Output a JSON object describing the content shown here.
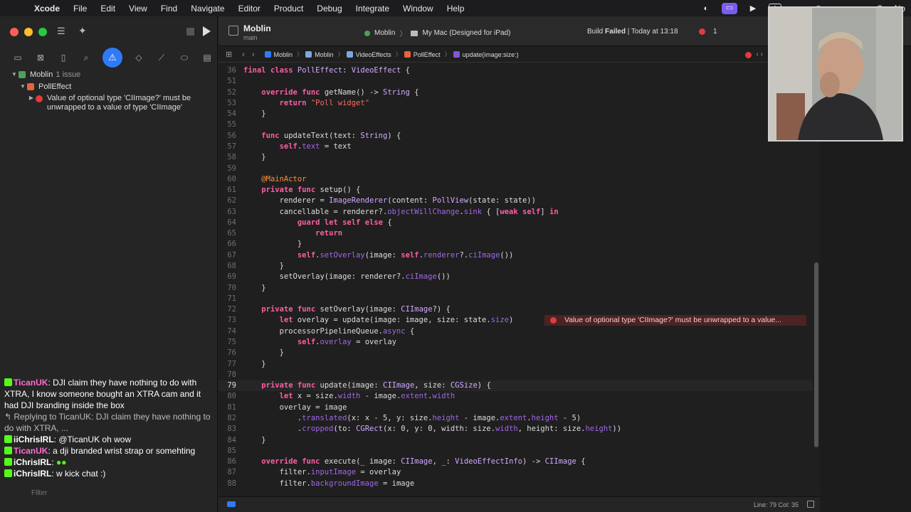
{
  "menubar": {
    "app_name": "Xcode",
    "items": [
      "File",
      "Edit",
      "View",
      "Find",
      "Navigate",
      "Editor",
      "Product",
      "Debug",
      "Integrate",
      "Window",
      "Help"
    ],
    "clock": "Sun No"
  },
  "toolbar": {
    "project_name": "Moblin",
    "branch": "main",
    "scheme": "Moblin",
    "destination": "My Mac (Designed for iPad)",
    "status_prefix": "Build",
    "status_bold": "Failed",
    "status_suffix": "| Today at 13:18",
    "error_count": "1"
  },
  "jumpbar": {
    "crumbs": [
      "Moblin",
      "Moblin",
      "VideoEffects",
      "PollEffect",
      "update(image:size:)"
    ]
  },
  "navigator": {
    "project": "Moblin",
    "issue_count": "1 issue",
    "file": "PollEffect",
    "error_message": "Value of optional type 'CIImage?' must be unwrapped to a value of type 'CIImage'"
  },
  "chat": {
    "msg1_user": "TicanUK",
    "msg1_text": ": DJI claim they have nothing to do with XTRA, I know someone bought an XTRA cam and it had DJI branding inside the box",
    "reply": "Replying to TicanUK: DJI claim they have nothing to do with XTRA, ...",
    "msg2_user": "iiChrisIRL",
    "msg2_text": ": @TicanUK oh wow",
    "msg3_user": "TicanUK",
    "msg3_text": ": a dji branded wrist strap or somehting",
    "msg4_user": "iChrisIRL",
    "msg4_text": ":",
    "msg5_user": "iChrisIRL",
    "msg5_text": ": w kick chat :)",
    "filter_placeholder": "Filter"
  },
  "editor": {
    "inline_error": "Value of optional type 'CIImage?' must be unwrapped to a value...",
    "lines": [
      {
        "n": "36",
        "code": "final class PollEffect: VideoEffect {"
      },
      {
        "n": "51",
        "code": ""
      },
      {
        "n": "52",
        "code": "    override func getName() -> String {"
      },
      {
        "n": "53",
        "code": "        return \"Poll widget\""
      },
      {
        "n": "54",
        "code": "    }"
      },
      {
        "n": "55",
        "code": ""
      },
      {
        "n": "56",
        "code": "    func updateText(text: String) {"
      },
      {
        "n": "57",
        "code": "        self.text = text"
      },
      {
        "n": "58",
        "code": "    }"
      },
      {
        "n": "59",
        "code": ""
      },
      {
        "n": "60",
        "code": "    @MainActor"
      },
      {
        "n": "61",
        "code": "    private func setup() {"
      },
      {
        "n": "62",
        "code": "        renderer = ImageRenderer(content: PollView(state: state))"
      },
      {
        "n": "63",
        "code": "        cancellable = renderer?.objectWillChange.sink { [weak self] in"
      },
      {
        "n": "64",
        "code": "            guard let self else {"
      },
      {
        "n": "65",
        "code": "                return"
      },
      {
        "n": "66",
        "code": "            }"
      },
      {
        "n": "67",
        "code": "            self.setOverlay(image: self.renderer?.ciImage())"
      },
      {
        "n": "68",
        "code": "        }"
      },
      {
        "n": "69",
        "code": "        setOverlay(image: renderer?.ciImage())"
      },
      {
        "n": "70",
        "code": "    }"
      },
      {
        "n": "71",
        "code": ""
      },
      {
        "n": "72",
        "code": "    private func setOverlay(image: CIImage?) {"
      },
      {
        "n": "73",
        "code": "        let overlay = update(image: image, size: state.size)"
      },
      {
        "n": "74",
        "code": "        processorPipelineQueue.async {"
      },
      {
        "n": "75",
        "code": "            self.overlay = overlay"
      },
      {
        "n": "76",
        "code": "        }"
      },
      {
        "n": "77",
        "code": "    }"
      },
      {
        "n": "78",
        "code": ""
      },
      {
        "n": "79",
        "code": "    private func update(image: CIImage, size: CGSize) {"
      },
      {
        "n": "80",
        "code": "        let x = size.width - image.extent.width"
      },
      {
        "n": "81",
        "code": "        overlay = image"
      },
      {
        "n": "82",
        "code": "            .translated(x: x - 5, y: size.height - image.extent.height - 5)"
      },
      {
        "n": "83",
        "code": "            .cropped(to: CGRect(x: 0, y: 0, width: size.width, height: size.height))"
      },
      {
        "n": "84",
        "code": "    }"
      },
      {
        "n": "85",
        "code": ""
      },
      {
        "n": "86",
        "code": "    override func execute(_ image: CIImage, _: VideoEffectInfo) -> CIImage {"
      },
      {
        "n": "87",
        "code": "        filter.inputImage = overlay"
      },
      {
        "n": "88",
        "code": "        filter.backgroundImage = image"
      }
    ]
  },
  "statusbar": {
    "position": "Line: 79  Col: 35"
  },
  "colors": {
    "accent": "#2f7bf6",
    "error": "#e23b3b",
    "keyword": "#fc5fa3",
    "type": "#d0a8ff",
    "string": "#fc6a5d"
  }
}
